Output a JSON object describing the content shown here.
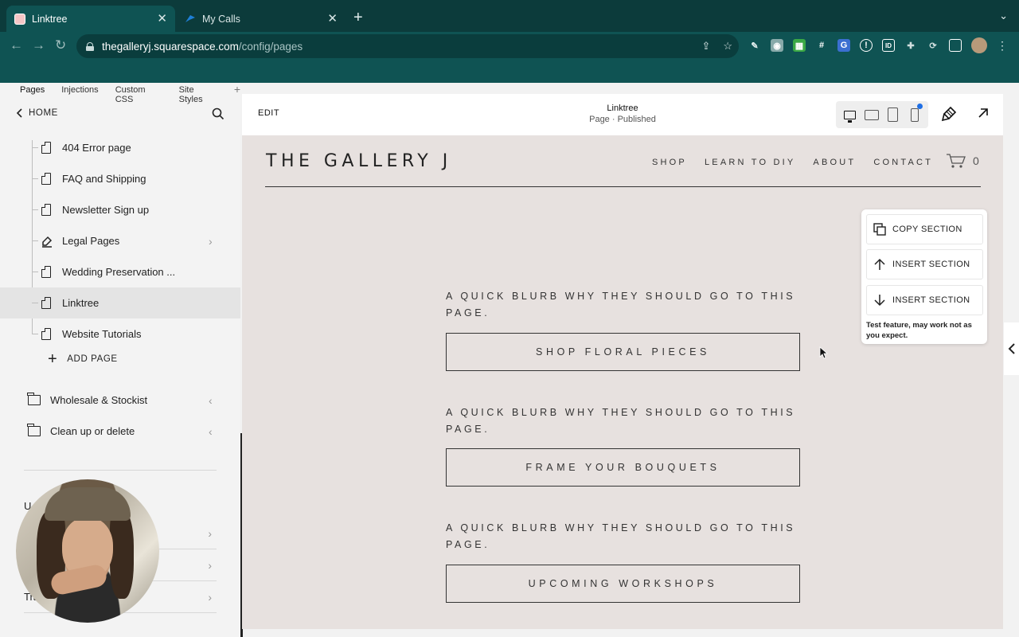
{
  "browser": {
    "tabs": [
      {
        "title": "Linktree",
        "favicon_color": "#f4c6c6",
        "active": true
      },
      {
        "title": "My Calls",
        "favicon_color": "#1e7fd6",
        "active": false
      }
    ],
    "url_host": "thegalleryj.squarespace.com",
    "url_path": "/config/pages",
    "icons": [
      "back-icon",
      "forward-icon",
      "reload-icon",
      "share-icon",
      "star-icon",
      "eyedropper-icon",
      "camera-icon",
      "extension-icon",
      "hashtag-icon",
      "translate-icon",
      "password-icon",
      "id-icon",
      "puzzle-icon",
      "sync-icon",
      "sidepanel-icon",
      "profile-avatar",
      "more-icon"
    ]
  },
  "sidebar": {
    "subtabs": [
      "Pages",
      "Injections",
      "Custom CSS",
      "Site Styles"
    ],
    "home_label": "HOME",
    "pages": [
      {
        "label": "404 Error page"
      },
      {
        "label": "FAQ and Shipping"
      },
      {
        "label": "Newsletter Sign up"
      },
      {
        "label": "Legal Pages"
      },
      {
        "label": "Wedding Preservation ..."
      },
      {
        "label": "Linktree"
      },
      {
        "label": "Website Tutorials"
      }
    ],
    "add_page_label": "ADD PAGE",
    "folders": [
      {
        "label": "Wholesale & Stockist"
      },
      {
        "label": "Clean up or delete"
      }
    ],
    "partial_section_label": "U",
    "partial_row_label": "Tra"
  },
  "editor": {
    "edit_label": "EDIT",
    "page_title": "Linktree",
    "page_status": "Page · Published",
    "device_modes": [
      "desktop-icon",
      "tablet-landscape-icon",
      "tablet-portrait-icon",
      "mobile-icon"
    ],
    "accent_color": "#1f6fe5"
  },
  "site": {
    "title": "THE GALLERY J",
    "nav": [
      "SHOP",
      "LEARN TO DIY",
      "ABOUT",
      "CONTACT"
    ],
    "cart_count": "0",
    "background_color": "#e7e1df",
    "blocks": [
      {
        "blurb": "A QUICK BLURB WHY THEY SHOULD GO TO THIS PAGE.",
        "button": "SHOP FLORAL PIECES"
      },
      {
        "blurb": "A QUICK BLURB WHY THEY SHOULD GO TO THIS PAGE.",
        "button": "FRAME YOUR BOUQUETS"
      },
      {
        "blurb": "A QUICK BLURB WHY THEY SHOULD GO TO THIS PAGE.",
        "button": "UPCOMING WORKSHOPS"
      }
    ]
  },
  "section_menu": {
    "copy": "COPY SECTION",
    "insert_above": "INSERT SECTION",
    "insert_below": "INSERT SECTION",
    "note": "Test feature, may work not as you expect."
  }
}
